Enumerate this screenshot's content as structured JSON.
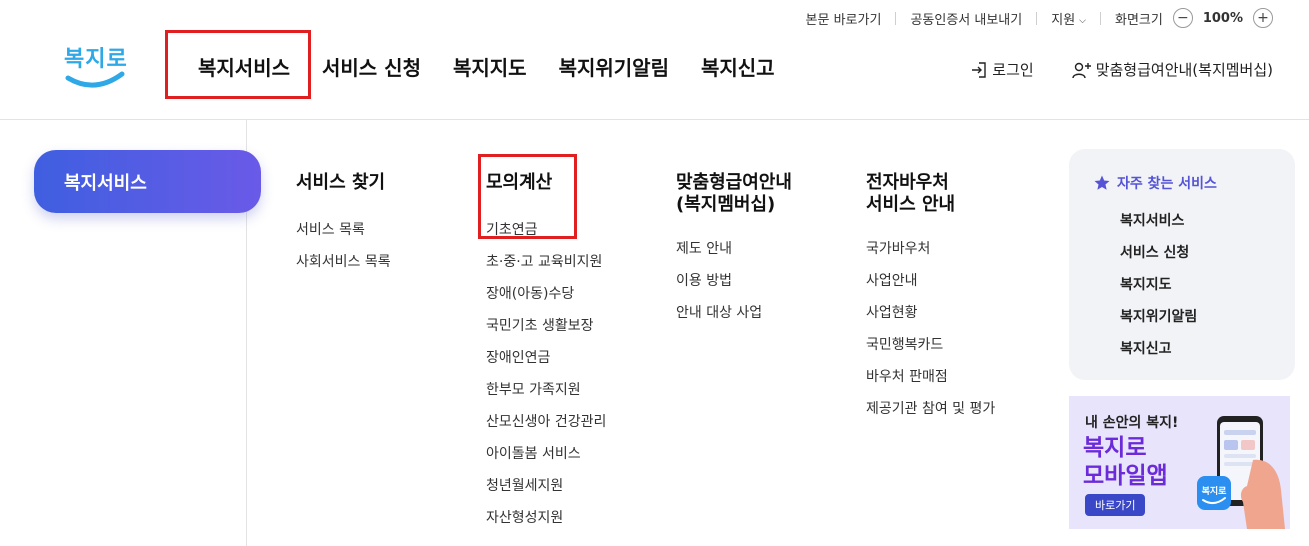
{
  "utility": {
    "skip_link": "본문 바로가기",
    "cert_export": "공동인증서 내보내기",
    "support": "지원",
    "screen_size": "화면크기",
    "zoom_minus": "−",
    "zoom_value": "100%",
    "zoom_plus": "+"
  },
  "logo": {
    "text": "복지로",
    "color": "#2ea8e6"
  },
  "nav": {
    "items": [
      {
        "label": "복지서비스"
      },
      {
        "label": "서비스 신청"
      },
      {
        "label": "복지지도"
      },
      {
        "label": "복지위기알림"
      },
      {
        "label": "복지신고"
      }
    ]
  },
  "actions": {
    "login": "로그인",
    "membership": "맞춤형급여안내(복지멤버십)"
  },
  "side": {
    "title": "복지서비스"
  },
  "columns": [
    {
      "title": "서비스 찾기",
      "links": [
        "서비스 목록",
        "사회서비스 목록"
      ]
    },
    {
      "title": "모의계산",
      "links": [
        "기초연금",
        "초·중·고 교육비지원",
        "장애(아동)수당",
        "국민기초 생활보장",
        "장애인연금",
        "한부모 가족지원",
        "산모신생아 건강관리",
        "아이돌봄 서비스",
        "청년월세지원",
        "자산형성지원"
      ]
    },
    {
      "title_line1": "맞춤형급여안내",
      "title_line2": "(복지멤버십)",
      "links": [
        "제도 안내",
        "이용 방법",
        "안내 대상 사업"
      ]
    },
    {
      "title_line1": "전자바우처",
      "title_line2": "서비스 안내",
      "links": [
        "국가바우처",
        "사업안내",
        "사업현황",
        "국민행복카드",
        "바우처 판매점",
        "제공기관 참여 및 평가"
      ]
    }
  ],
  "favorites": {
    "title": "자주 찾는 서비스",
    "items": [
      "복지서비스",
      "서비스 신청",
      "복지지도",
      "복지위기알림",
      "복지신고"
    ]
  },
  "banner": {
    "line1": "내 손안의 복지!",
    "line2": "복지로",
    "line3": "모바일앱",
    "button": "바로가기",
    "app_icon_text": "복지로"
  },
  "colors": {
    "accent": "#5553d6",
    "highlight_box": "#e02020",
    "pill_start": "#3f5fe0",
    "pill_end": "#6a5ae8"
  }
}
